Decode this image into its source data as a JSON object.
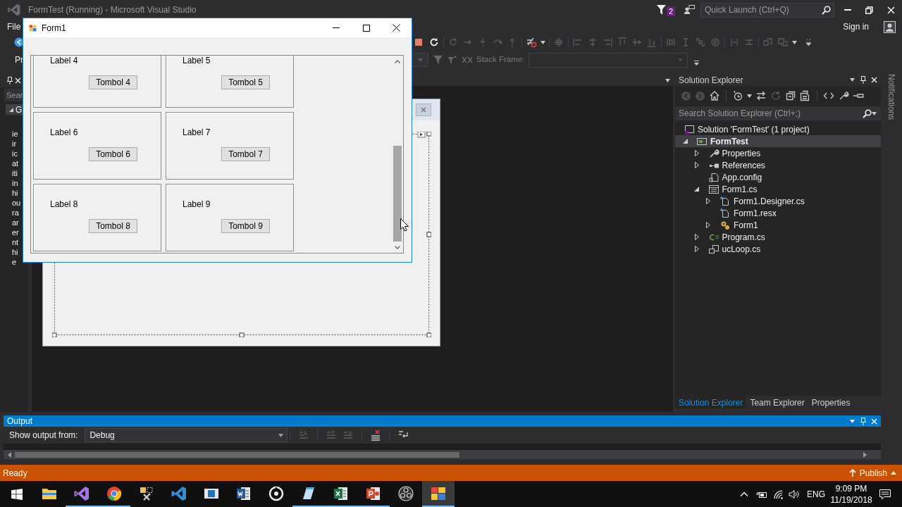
{
  "ide": {
    "title": "FormTest (Running) - Microsoft Visual Studio",
    "notification_count": "2",
    "quick_launch": {
      "placeholder": "Quick Launch (Ctrl+Q)"
    },
    "menu": [
      {
        "label": "File"
      }
    ],
    "account": "Sign in"
  },
  "debug_toolbar": {
    "project_label": "Pr",
    "stack_frame_label": "Stack Frame:"
  },
  "toolbox": {
    "search": {
      "placeholder": "Sear"
    },
    "group": {
      "label": "G",
      "expanded": true
    },
    "description_lines": [
      "ie",
      "ir",
      "ic",
      "at",
      "iti",
      "in",
      "hi",
      "ou",
      "ra",
      "ar",
      "er",
      "nt",
      "hi",
      "e"
    ]
  },
  "form_window": {
    "title": "Form1",
    "items": [
      {
        "label": "Label 4",
        "button": "Tombol 4"
      },
      {
        "label": "Label 5",
        "button": "Tombol 5"
      },
      {
        "label": "Label 6",
        "button": "Tombol 6"
      },
      {
        "label": "Label 7",
        "button": "Tombol 7"
      },
      {
        "label": "Label 8",
        "button": "Tombol 8"
      },
      {
        "label": "Label 9",
        "button": "Tombol 9"
      }
    ]
  },
  "solution_explorer": {
    "title": "Solution Explorer",
    "search": {
      "placeholder": "Search Solution Explorer (Ctrl+;)"
    },
    "tree": [
      {
        "label": "Solution 'FormTest' (1 project)",
        "kind": "solution",
        "selected": false,
        "children": [
          {
            "label": "FormTest",
            "kind": "project",
            "expanded": true,
            "selected": true,
            "children": [
              {
                "label": "Properties",
                "kind": "properties",
                "expanded": false,
                "selected": false
              },
              {
                "label": "References",
                "kind": "references",
                "expanded": false,
                "selected": false
              },
              {
                "label": "App.config",
                "kind": "config",
                "selected": false
              },
              {
                "label": "Form1.cs",
                "kind": "form",
                "expanded": true,
                "selected": false,
                "children": [
                  {
                    "label": "Form1.Designer.cs",
                    "kind": "code-file",
                    "expanded": false,
                    "selected": false
                  },
                  {
                    "label": "Form1.resx",
                    "kind": "code-file",
                    "selected": false
                  },
                  {
                    "label": "Form1",
                    "kind": "class",
                    "expanded": false,
                    "selected": false
                  }
                ]
              },
              {
                "label": "Program.cs",
                "kind": "csharp",
                "expanded": false,
                "selected": false
              },
              {
                "label": "ucLoop.cs",
                "kind": "user-control",
                "expanded": false,
                "selected": false
              }
            ]
          }
        ]
      }
    ],
    "tabs": [
      {
        "label": "Solution Explorer",
        "selected": true
      },
      {
        "label": "Team Explorer",
        "selected": false
      },
      {
        "label": "Properties",
        "selected": false
      }
    ]
  },
  "notifications_tab": {
    "label": "Notifications"
  },
  "output": {
    "title": "Output",
    "source_label": "Show output from:",
    "source": "Debug"
  },
  "status_bar": {
    "text": "Ready",
    "publish": "Publish"
  },
  "taskbar": {
    "apps": [
      {
        "kind": "file-explorer",
        "running": false,
        "active": false
      },
      {
        "kind": "visual-studio",
        "running": true,
        "active": false
      },
      {
        "kind": "browser",
        "running": true,
        "active": false
      },
      {
        "kind": "tools",
        "running": false,
        "active": false
      },
      {
        "kind": "code-editor",
        "running": false,
        "active": false
      },
      {
        "kind": "window-app",
        "running": false,
        "active": false
      },
      {
        "kind": "word",
        "running": false,
        "active": false
      },
      {
        "kind": "ring-app",
        "running": false,
        "active": false
      },
      {
        "kind": "notepad",
        "running": true,
        "active": false
      },
      {
        "kind": "excel",
        "running": true,
        "active": false
      },
      {
        "kind": "powerpoint",
        "running": true,
        "active": false
      },
      {
        "kind": "recorder",
        "running": false,
        "active": false
      },
      {
        "kind": "form-app",
        "running": true,
        "active": true
      }
    ],
    "tray": {
      "language": "ENG",
      "time": "9:09 PM",
      "date": "11/19/2018"
    }
  }
}
